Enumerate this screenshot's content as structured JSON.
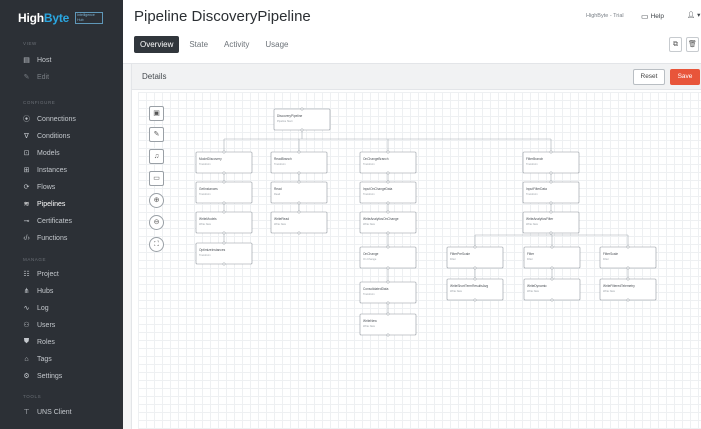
{
  "brand": {
    "name_part1": "High",
    "name_part2": "Byte",
    "badge": "Intelligence Hub"
  },
  "sidebar": {
    "sections": {
      "view": "VIEW",
      "configure": "CONFIGURE",
      "manage": "MANAGE",
      "tools": "TOOLS"
    },
    "view_items": [
      {
        "label": "Host",
        "icon": "host-icon"
      },
      {
        "label": "Edit",
        "icon": "edit-icon"
      }
    ],
    "configure_items": [
      {
        "label": "Connections",
        "icon": "connections-icon"
      },
      {
        "label": "Conditions",
        "icon": "conditions-icon"
      },
      {
        "label": "Models",
        "icon": "models-icon"
      },
      {
        "label": "Instances",
        "icon": "instances-icon"
      },
      {
        "label": "Flows",
        "icon": "flows-icon"
      },
      {
        "label": "Pipelines",
        "icon": "pipelines-icon"
      },
      {
        "label": "Certificates",
        "icon": "certificates-icon"
      },
      {
        "label": "Functions",
        "icon": "functions-icon"
      }
    ],
    "manage_items": [
      {
        "label": "Project",
        "icon": "project-icon"
      },
      {
        "label": "Hubs",
        "icon": "hubs-icon"
      },
      {
        "label": "Log",
        "icon": "log-icon"
      },
      {
        "label": "Users",
        "icon": "users-icon"
      },
      {
        "label": "Roles",
        "icon": "roles-icon"
      },
      {
        "label": "Tags",
        "icon": "tags-icon"
      },
      {
        "label": "Settings",
        "icon": "settings-icon"
      }
    ],
    "tools_items": [
      {
        "label": "UNS Client",
        "icon": "uns-client-icon"
      }
    ]
  },
  "header": {
    "title": "Pipeline DiscoveryPipeline",
    "trial": "HighByte - Trial",
    "help": "Help"
  },
  "tabs": [
    "Overview",
    "State",
    "Activity",
    "Usage"
  ],
  "panel": {
    "title": "Details",
    "reset": "Reset",
    "save": "Save"
  },
  "flow": {
    "nodes": [
      {
        "id": "root",
        "title": "DiscoveryPipeline",
        "sub": "Pipeline Start"
      },
      {
        "id": "a1",
        "title": "ModelDiscovery",
        "sub": "Transform"
      },
      {
        "id": "a2",
        "title": "GetInstances",
        "sub": "Transform"
      },
      {
        "id": "a3",
        "title": "WriteModels",
        "sub": "Write New"
      },
      {
        "id": "a4",
        "title": "OptimizeInstances",
        "sub": "Transform"
      },
      {
        "id": "b1",
        "title": "ReadBranch",
        "sub": "Transform"
      },
      {
        "id": "b2",
        "title": "Read",
        "sub": "Read"
      },
      {
        "id": "b3",
        "title": "WriteRead",
        "sub": "Write New"
      },
      {
        "id": "c1",
        "title": "OnChangeBranch",
        "sub": "Transform"
      },
      {
        "id": "c2",
        "title": "InputOnChangeData",
        "sub": "Transform"
      },
      {
        "id": "c3",
        "title": "WriteAnalyticsOnChange",
        "sub": "Write New"
      },
      {
        "id": "c4",
        "title": "OnChange",
        "sub": "On Change"
      },
      {
        "id": "c5",
        "title": "ConsolidatedData",
        "sub": "Transform"
      },
      {
        "id": "c6",
        "title": "WriteNew",
        "sub": "Write New"
      },
      {
        "id": "d1",
        "title": "FilterBranch",
        "sub": "Transform"
      },
      {
        "id": "d2",
        "title": "InputFilterData",
        "sub": "Transform"
      },
      {
        "id": "d3",
        "title": "WriteAnalyticsFilter",
        "sub": "Write New"
      },
      {
        "id": "e1",
        "title": "FilterPreScale",
        "sub": "Filter"
      },
      {
        "id": "e2",
        "title": "WriteShortTermResultsAvg",
        "sub": "Write New"
      },
      {
        "id": "f1",
        "title": "Filter",
        "sub": "Filter"
      },
      {
        "id": "f2",
        "title": "WriteDynamic",
        "sub": "Write New"
      },
      {
        "id": "g1",
        "title": "FilterScale",
        "sub": "Filter"
      },
      {
        "id": "g2",
        "title": "WriteFilteredTelemetry",
        "sub": "Write New"
      }
    ]
  }
}
